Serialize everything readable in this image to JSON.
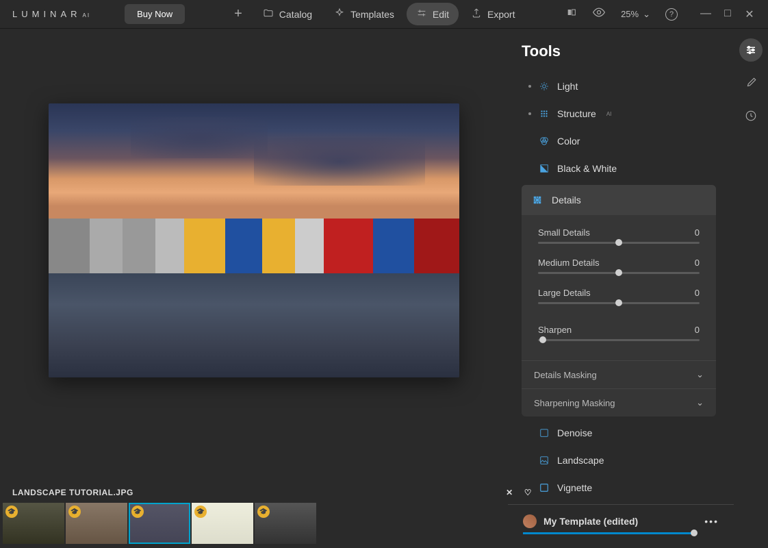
{
  "app": {
    "name": "LUMINAR",
    "suffix": "AI"
  },
  "header": {
    "buy": "Buy Now",
    "nav": {
      "catalog": "Catalog",
      "templates": "Templates",
      "edit": "Edit",
      "export": "Export"
    },
    "zoom": "25%"
  },
  "tools": {
    "title": "Tools",
    "light": "Light",
    "structure": "Structure",
    "color": "Color",
    "black_white": "Black & White",
    "details": "Details",
    "denoise": "Denoise",
    "landscape": "Landscape",
    "vignette": "Vignette"
  },
  "details_panel": {
    "small": {
      "label": "Small Details",
      "value": "0"
    },
    "medium": {
      "label": "Medium Details",
      "value": "0"
    },
    "large": {
      "label": "Large Details",
      "value": "0"
    },
    "sharpen": {
      "label": "Sharpen",
      "value": "0"
    },
    "details_masking": "Details Masking",
    "sharpening_masking": "Sharpening Masking"
  },
  "file": {
    "name": "LANDSCAPE TUTORIAL.JPG"
  },
  "template": {
    "label": "My Template (edited)"
  }
}
